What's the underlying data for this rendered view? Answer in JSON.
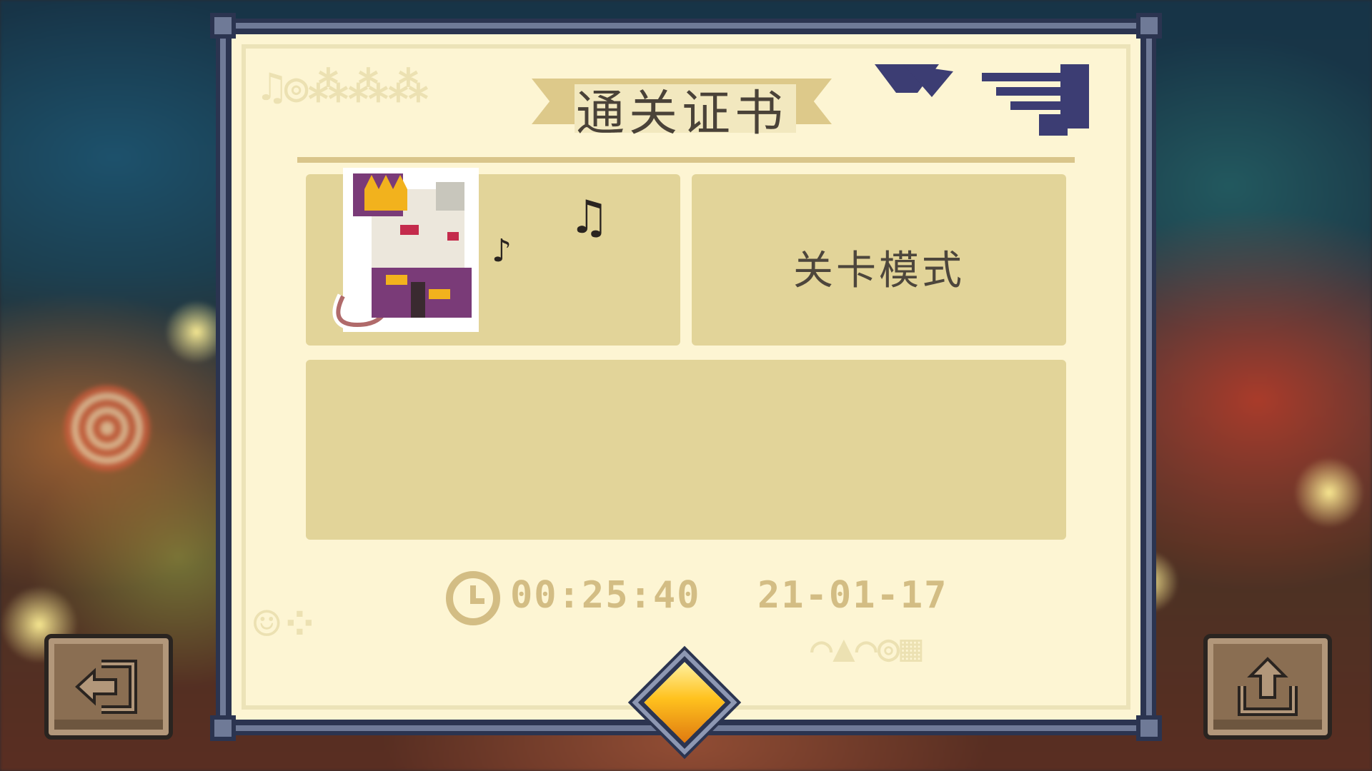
{
  "certificate": {
    "title": "通关证书",
    "mode_label": "关卡模式",
    "clear_time": "00:25:40",
    "clear_date": "21-01-17"
  },
  "buttons": {
    "exit_icon": "exit-icon",
    "share_icon": "share-icon"
  },
  "colors": {
    "panel_bg": "#fdf5d3",
    "box_bg": "#e2d499",
    "accent_gold": "#d3bd84",
    "frame_dark": "#2b3450"
  }
}
